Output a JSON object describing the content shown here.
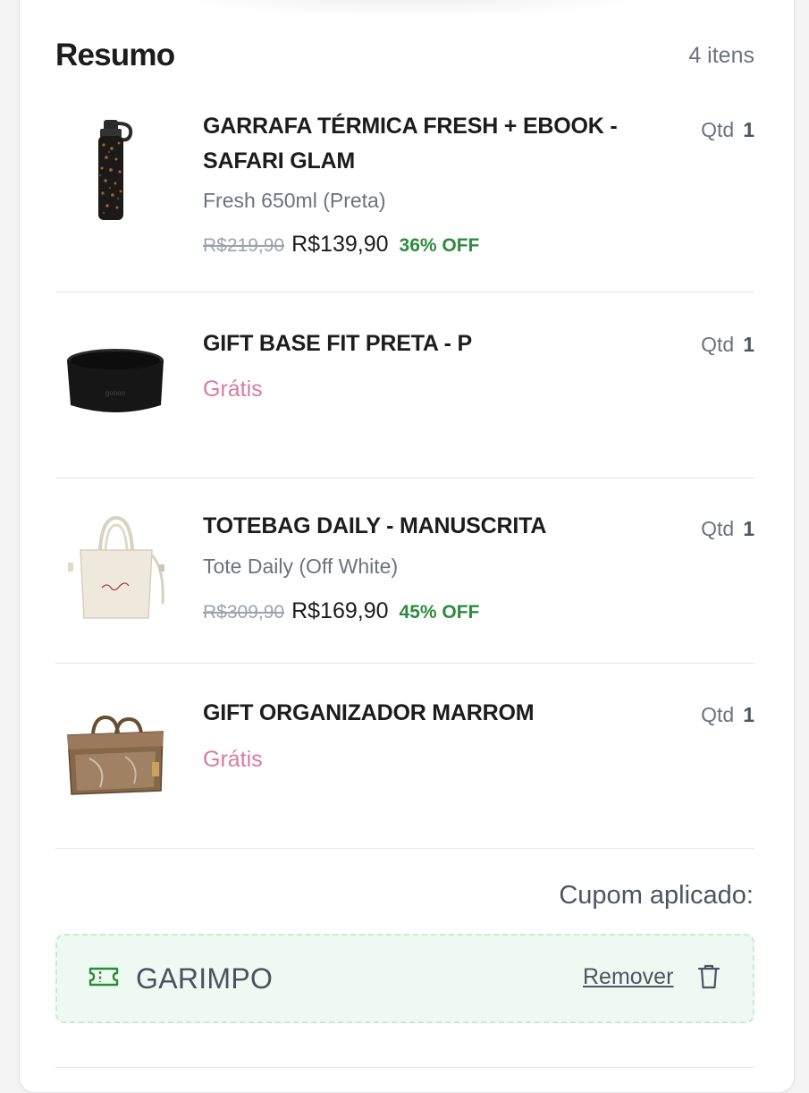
{
  "summary": {
    "title": "Resumo",
    "count": "4 itens"
  },
  "items": [
    {
      "name_line1": "GARRAFA TÉRMICA FRESH + EBOOK -",
      "name_line2": "SAFARI GLAM",
      "variant": "Fresh 650ml (Preta)",
      "old_price": "R$219,90",
      "price": "R$139,90",
      "discount": "36% OFF",
      "qty_label": "Qtd",
      "qty": "1"
    },
    {
      "name_line1": "GIFT BASE FIT PRETA - P",
      "free": "Grátis",
      "qty_label": "Qtd",
      "qty": "1"
    },
    {
      "name_line1": "TOTEBAG DAILY - MANUSCRITA",
      "variant": "Tote Daily (Off White)",
      "old_price": "R$309,90",
      "price": "R$169,90",
      "discount": "45% OFF",
      "qty_label": "Qtd",
      "qty": "1"
    },
    {
      "name_line1": "GIFT ORGANIZADOR MARROM",
      "free": "Grátis",
      "qty_label": "Qtd",
      "qty": "1"
    }
  ],
  "coupon": {
    "label": "Cupom aplicado:",
    "code": "GARIMPO",
    "remove_label": "Remover"
  },
  "colors": {
    "discount": "#2e8b3e",
    "free": "#d97aa8",
    "coupon_bg": "#eefaf1",
    "coupon_border": "#c7ecd1"
  },
  "icons": {
    "coupon": "ticket-icon",
    "remove": "trash-icon"
  }
}
